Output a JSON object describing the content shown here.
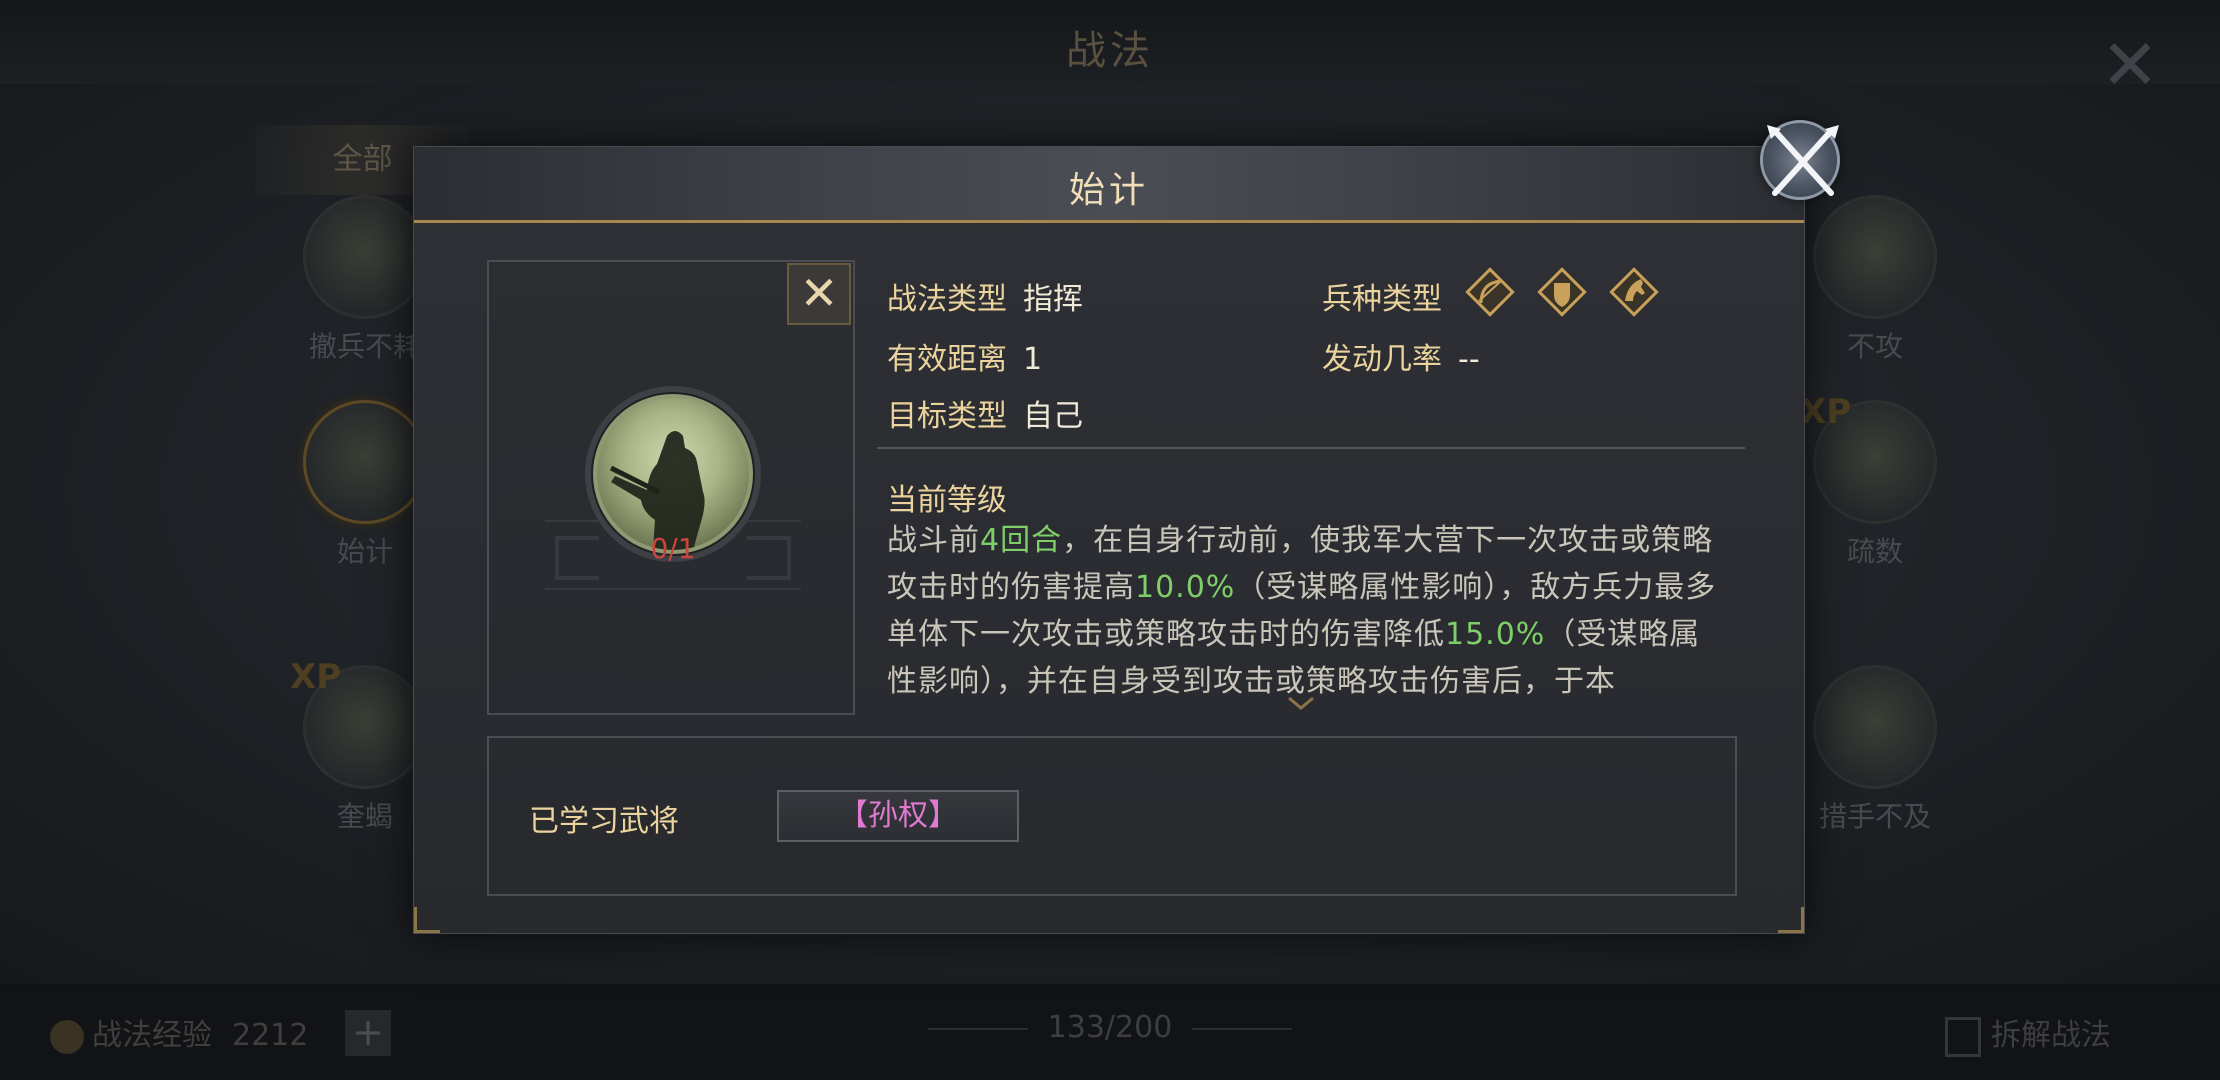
{
  "background": {
    "title": "战法",
    "tab_all": "全部",
    "cards": [
      {
        "label": "撤兵不耗"
      },
      {
        "label": "始计"
      },
      {
        "label": "奎蝎"
      },
      {
        "label": "不攻"
      },
      {
        "label": "疏数"
      },
      {
        "label": "措手不及"
      }
    ],
    "exp_label": "战法经验",
    "exp_value": "2212",
    "plus_label": "+",
    "page_counter": "133/200",
    "dismantle_label": "拆解战法"
  },
  "modal": {
    "title": "始计",
    "skill_level": "0/1",
    "close_glyph": "✕",
    "attributes": {
      "type_label": "战法类型",
      "type_value": "指挥",
      "range_label": "有效距离",
      "range_value": "1",
      "target_label": "目标类型",
      "target_value": "自己",
      "troop_label": "兵种类型",
      "trigger_label": "发动几率",
      "trigger_value": "--"
    },
    "troop_icons": [
      "archer-icon",
      "shield-infantry-icon",
      "cavalry-icon"
    ],
    "current_level_label": "当前等级",
    "description": {
      "p1": "战斗前",
      "h1": "4回合",
      "p2": "，在自身行动前，使我军大营下一次攻击或策略攻击时的伤害提高",
      "h2": "10.0%",
      "p3": "（受谋略属性影响），敌方兵力最多单体下一次攻击或策略攻击时的伤害降低",
      "h3": "15.0%",
      "p4": "（受谋略属性影响），并在自身受到攻击或策略攻击伤害后，于本"
    },
    "learned_label": "已学习武将",
    "learned_general": "【孙权】"
  },
  "colors": {
    "gold_text": "#ead39d",
    "highlight_green": "#7fcf68",
    "general_pink": "#e07ad0",
    "level_red": "#c8463e",
    "title_border": "#a8874e"
  }
}
